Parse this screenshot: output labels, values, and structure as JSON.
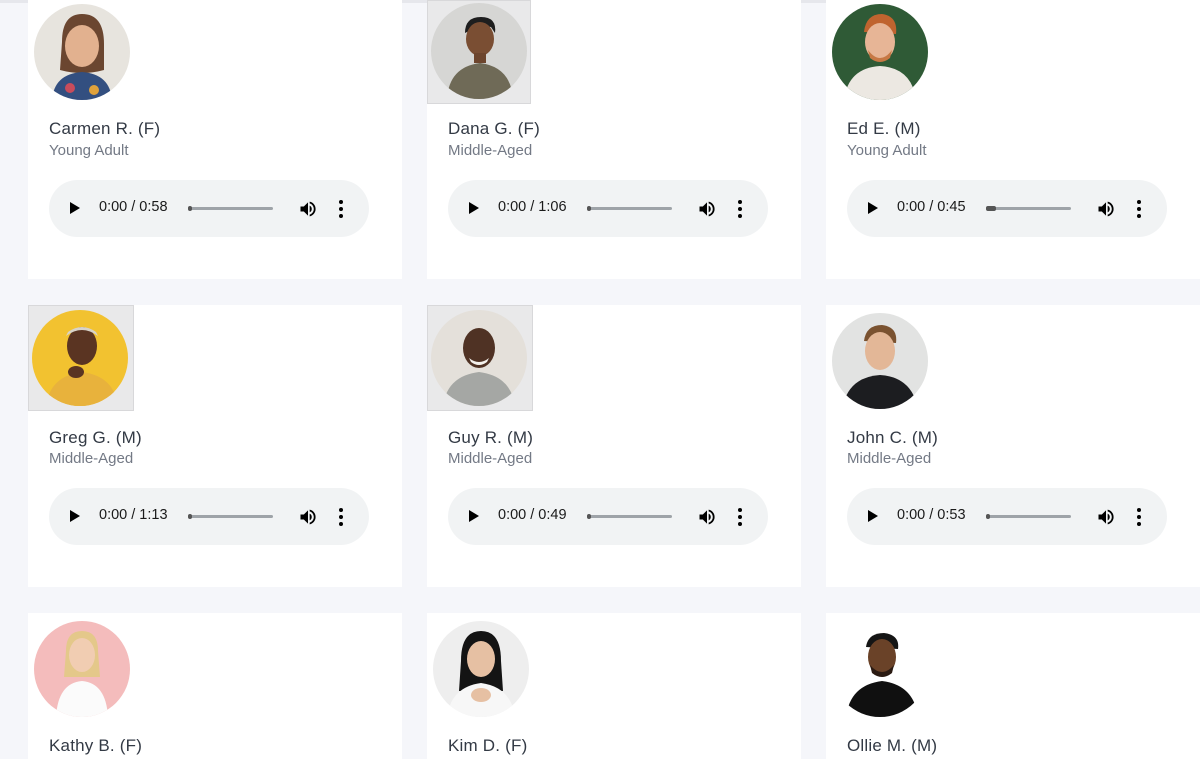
{
  "cards": [
    {
      "name": "Carmen R. (F)",
      "age": "Young Adult",
      "time": "0:00 / 0:58",
      "progress": 0.04
    },
    {
      "name": "Dana G. (F)",
      "age": "Middle-Aged",
      "time": "0:00 / 1:06",
      "progress": 0.02
    },
    {
      "name": "Ed E. (M)",
      "age": "Young Adult",
      "time": "0:00 / 0:45",
      "progress": 0.12
    },
    {
      "name": "Greg G. (M)",
      "age": "Middle-Aged",
      "time": "0:00 / 1:13",
      "progress": 0.04
    },
    {
      "name": "Guy R. (M)",
      "age": "Middle-Aged",
      "time": "0:00 / 0:49",
      "progress": 0.02
    },
    {
      "name": "John C. (M)",
      "age": "Middle-Aged",
      "time": "0:00 / 0:53",
      "progress": 0.02
    },
    {
      "name": "Kathy B. (F)"
    },
    {
      "name": "Kim D. (F)"
    },
    {
      "name": "Ollie M. (M)"
    }
  ],
  "icons": {
    "play": "play-icon",
    "volume": "volume-icon",
    "more": "more-options-icon"
  },
  "colors": {
    "page_bg": "#f5f6fa",
    "card_bg": "#ffffff",
    "player_bg": "#f1f3f4"
  }
}
